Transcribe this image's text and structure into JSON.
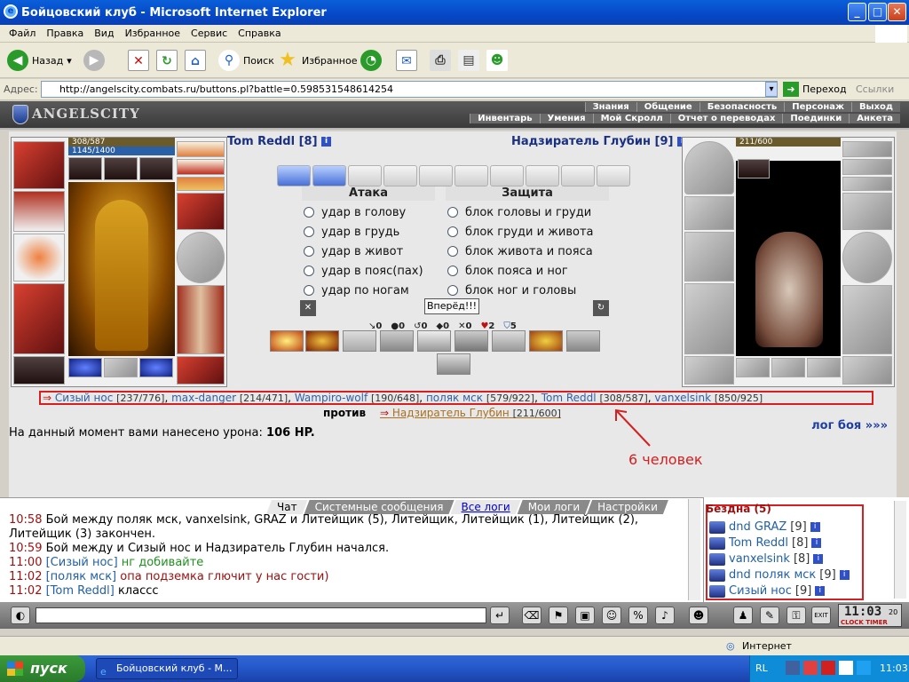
{
  "window": {
    "title": "Бойцовский клуб - Microsoft Internet Explorer",
    "minimize": "_",
    "maximize": "□",
    "close": "✕"
  },
  "menu": [
    "Файл",
    "Правка",
    "Вид",
    "Избранное",
    "Сервис",
    "Справка"
  ],
  "toolbar": {
    "back": "Назад",
    "search": "Поиск",
    "favorites": "Избранное"
  },
  "address": {
    "label": "Адрес:",
    "url": "http://angelscity.combats.ru/buttons.pl?battle=0.598531548614254",
    "go": "Переход",
    "links": "Ссылки"
  },
  "game": {
    "logo": "ANGELSCITY",
    "nav_top": [
      "Знания",
      "Общение",
      "Безопасность",
      "Персонаж",
      "Выход"
    ],
    "nav_bottom": [
      "Инвентарь",
      "Умения",
      "Мой Скролл",
      "Отчет о переводах",
      "Поединки",
      "Анкета"
    ],
    "player": {
      "name": "Tom Reddl",
      "level": "[8]",
      "hp": "308/587",
      "mana": "1145/1400"
    },
    "opponent": {
      "name": "Надзиратель Глубин",
      "level": "[9]",
      "hp": "211/600"
    },
    "attack_title": "Атака",
    "defense_title": "Защита",
    "attacks": [
      "удар в голову",
      "удар в грудь",
      "удар в живот",
      "удар в пояс(пах)",
      "удар по ногам"
    ],
    "defenses": [
      "блок головы и груди",
      "блок груди и живота",
      "блок живота и пояса",
      "блок пояса и ног",
      "блок ног и головы"
    ],
    "go_button": "Вперёд!!!",
    "stats": [
      "0",
      "0",
      "0",
      "0",
      "0",
      "2",
      "5"
    ],
    "fighters": [
      {
        "name": "Сизый нос",
        "hp": "[237/776]"
      },
      {
        "name": "max-danger",
        "hp": "[214/471]"
      },
      {
        "name": "Wampiro-wolf",
        "hp": "[190/648]"
      },
      {
        "name": "поляк мск",
        "hp": "[579/922]"
      },
      {
        "name": "Tom Reddl",
        "hp": "[308/587]"
      },
      {
        "name": "vanxelsink",
        "hp": "[850/925]"
      }
    ],
    "versus": "против",
    "enemy": "Надзиратель Глубин",
    "enemy_hp": "[211/600]",
    "damage_text": "На данный момент вами нанесено урона:",
    "damage_value": "106 HP.",
    "battle_log": "лог боя »»»",
    "annotation": "6 человек"
  },
  "chat": {
    "tabs": [
      "Чат",
      "Системные сообщения",
      "Все логи",
      "Мои логи",
      "Настройки"
    ],
    "lines": [
      {
        "time": "10:58",
        "text": "Бой между поляк мск, vanxelsink, GRAZ и Литейщик (5), Литейщик, Литейщик (1), Литейщик (2), Литейщик (3) закончен."
      },
      {
        "time": "10:59",
        "text": "Бой между и Сизый нос и Надзиратель Глубин начался."
      },
      {
        "time": "11:00",
        "who": "[Сизый нос]",
        "msg": "нг добивайте"
      },
      {
        "time": "11:02",
        "who": "[поляк мск]",
        "msg": "опа подземка глючит у нас гости)"
      },
      {
        "time": "11:02",
        "who": "[Tom Reddl]",
        "msg": "классс"
      }
    ]
  },
  "room": {
    "title": "Бездна (5)",
    "users": [
      {
        "name": "dnd GRAZ",
        "level": "[9]"
      },
      {
        "name": "Tom Reddl",
        "level": "[8]"
      },
      {
        "name": "vanxelsink",
        "level": "[8]"
      },
      {
        "name": "dnd поляк мск",
        "level": "[9]"
      },
      {
        "name": "Сизый нос",
        "level": "[9]"
      }
    ]
  },
  "clock": {
    "time": "11:03",
    "seconds": "20",
    "labels": "CLOCK TIMER",
    "exit": "EXIT"
  },
  "status": {
    "zone": "Интернет"
  },
  "taskbar": {
    "start": "пуск",
    "item": "Бойцовский клуб - М...",
    "lang": "RL",
    "time": "11:03"
  }
}
